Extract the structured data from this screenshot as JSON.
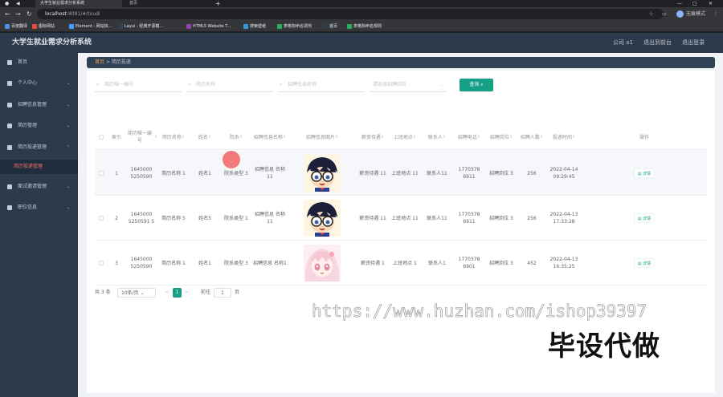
{
  "browser": {
    "tabs": [
      {
        "label": "大学生就业需求分析系统",
        "active": true
      },
      {
        "label": "首页",
        "active": false
      }
    ],
    "url_host": "localhost",
    "url_path": ":8081/#/toudi",
    "profile_label": "无痕模式",
    "bookmarks": [
      {
        "label": "百度翻译",
        "color": "#4a90e2"
      },
      {
        "label": "图标网站",
        "color": "#e74c3c"
      },
      {
        "label": "Element - 网站快...",
        "color": "#409eff"
      },
      {
        "label": "Layui - 经典开源模...",
        "color": "#2f4056"
      },
      {
        "label": "HTML5 Website T...",
        "color": "#8e44ad"
      },
      {
        "label": "搜索壁纸",
        "color": "#3498db"
      },
      {
        "label": "表格狗命名调剂",
        "color": "#27ae60"
      },
      {
        "label": "首页",
        "color": "#2c3e50"
      },
      {
        "label": "表格狗命名规则",
        "color": "#27ae60"
      }
    ]
  },
  "header": {
    "title": "大学生就业需求分析系统",
    "links": [
      "公司 a1",
      "退出到前台",
      "退出登录"
    ]
  },
  "sidebar": {
    "items": [
      {
        "label": "首页",
        "has_children": false
      },
      {
        "label": "个人中心",
        "has_children": true
      },
      {
        "label": "招聘信息管理",
        "has_children": true
      },
      {
        "label": "简历管理",
        "has_children": true
      },
      {
        "label": "简历投递管理",
        "has_children": true
      },
      {
        "label": "面试邀请管理",
        "has_children": true
      },
      {
        "label": "职位信息",
        "has_children": true
      }
    ],
    "active_sub": "简历投递管理"
  },
  "breadcrumb": {
    "home": "首页",
    "separator": ">",
    "current": "简历投递"
  },
  "search": {
    "fields": [
      {
        "placeholder": "简历唯一编号"
      },
      {
        "placeholder": "简历名称"
      },
      {
        "placeholder": "招聘信息名称"
      },
      {
        "placeholder": "请选择招聘岗位"
      }
    ],
    "button_label": "查询"
  },
  "table": {
    "columns": [
      {
        "label": "索引",
        "sortable": false
      },
      {
        "label": "简历唯一编号",
        "sortable": true
      },
      {
        "label": "简历名称",
        "sortable": true
      },
      {
        "label": "姓名",
        "sortable": true
      },
      {
        "label": "院系",
        "sortable": true
      },
      {
        "label": "招聘信息名称",
        "sortable": true
      },
      {
        "label": "招聘信息图片",
        "sortable": true
      },
      {
        "label": "薪资待遇",
        "sortable": true
      },
      {
        "label": "上班地点",
        "sortable": true
      },
      {
        "label": "联系人",
        "sortable": true
      },
      {
        "label": "招聘电话",
        "sortable": true
      },
      {
        "label": "招聘岗位",
        "sortable": true
      },
      {
        "label": "招聘人数",
        "sortable": true
      },
      {
        "label": "投递时间",
        "sortable": true
      },
      {
        "label": "操作",
        "sortable": false
      }
    ],
    "rows": [
      {
        "index": "1",
        "code": "1645000 5250590",
        "resume": "简历名称 1",
        "name": "姓名1",
        "dept": "院系类型 3",
        "job": "招聘信息 名称11",
        "image": "anime-boy",
        "salary": "薪资待遇 11",
        "place": "上班地点 11",
        "contact": "联系人11",
        "phone": "1770378 6911",
        "post": "招聘岗位 3",
        "count": "256",
        "time": "2022-04-14 09:29:45",
        "action": "详情"
      },
      {
        "index": "2",
        "code": "1645000 5250591 5",
        "resume": "简历名称 5",
        "name": "姓名5",
        "dept": "院系类型 1",
        "job": "招聘信息 名称11",
        "image": "anime-boy",
        "salary": "薪资待遇 11",
        "place": "上班地点 11",
        "contact": "联系人11",
        "phone": "1770378 6911",
        "post": "招聘岗位 3",
        "count": "256",
        "time": "2022-04-13 17:33:28",
        "action": "详情"
      },
      {
        "index": "3",
        "code": "1645000 5250590",
        "resume": "简历名称 1",
        "name": "姓名1",
        "dept": "院系类型 3",
        "job": "招聘信息 名称1",
        "image": "anime-girl",
        "salary": "薪资待遇 1",
        "place": "上班地点 1",
        "contact": "联系人1",
        "phone": "1770378 6901",
        "post": "招聘岗位 3",
        "count": "452",
        "time": "2022-04-13 16:35:25",
        "action": "详情"
      }
    ]
  },
  "pager": {
    "total": "共 3 条",
    "size": "10条/页",
    "prev": "<",
    "page": "1",
    "next": ">",
    "goto": "前往",
    "goto_value": "1",
    "unit": "页"
  },
  "watermark": {
    "url": "https://www.huzhan.com/ishop39397",
    "text": "毕设代做"
  },
  "colors": {
    "accent": "#16a085",
    "sidebar": "#2d3a4b",
    "breadcrumb_home": "#e6a23c",
    "active_menu": "#f56c6c"
  }
}
